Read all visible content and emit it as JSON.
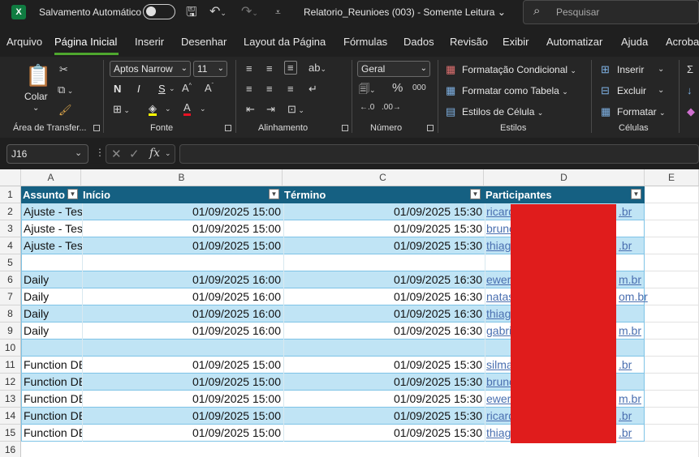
{
  "titlebar": {
    "app_icon": "X",
    "autosave_label": "Salvamento Automático",
    "doc_title": "Relatorio_Reunioes (003)  -  Somente Leitura",
    "search_placeholder": "Pesquisar"
  },
  "tabs": [
    "Arquivo",
    "Página Inicial",
    "Inserir",
    "Desenhar",
    "Layout da Página",
    "Fórmulas",
    "Dados",
    "Revisão",
    "Exibir",
    "Automatizar",
    "Ajuda",
    "Acrobat"
  ],
  "ribbon": {
    "paste_label": "Colar",
    "font_name": "Aptos Narrow",
    "font_size": "11",
    "bold": "N",
    "italic": "I",
    "underline": "S",
    "number_format": "Geral",
    "cond_format": "Formatação Condicional",
    "format_table": "Formatar como Tabela",
    "cell_styles": "Estilos de Célula",
    "insert": "Inserir",
    "delete": "Excluir",
    "format": "Formatar",
    "groups": {
      "clipboard": "Área de Transfer...",
      "font": "Fonte",
      "alignment": "Alinhamento",
      "number": "Número",
      "styles": "Estilos",
      "cells": "Células"
    }
  },
  "formula_bar": {
    "namebox": "J16",
    "fx": "fx",
    "formula": ""
  },
  "grid": {
    "columns": [
      "A",
      "B",
      "C",
      "D",
      "E"
    ],
    "headers": [
      "Assunto",
      "Início",
      "Término",
      "Participantes"
    ],
    "rows": [
      {
        "n": "2",
        "a": "Ajuste - Teste",
        "b": "01/09/2025 15:00",
        "c": "01/09/2025 15:30",
        "d": "ricardo",
        "d2": ".br"
      },
      {
        "n": "3",
        "a": "Ajuste - Teste",
        "b": "01/09/2025 15:00",
        "c": "01/09/2025 15:30",
        "d": "bruno",
        "d2": ""
      },
      {
        "n": "4",
        "a": "Ajuste - Teste",
        "b": "01/09/2025 15:00",
        "c": "01/09/2025 15:30",
        "d": "thiago",
        "d2": ".br"
      },
      {
        "n": "5",
        "a": "",
        "b": "",
        "c": "",
        "d": "",
        "d2": ""
      },
      {
        "n": "6",
        "a": "Daily",
        "b": "01/09/2025 16:00",
        "c": "01/09/2025 16:30",
        "d": "ewert",
        "d2": "m.br"
      },
      {
        "n": "7",
        "a": "Daily",
        "b": "01/09/2025 16:00",
        "c": "01/09/2025 16:30",
        "d": "natas",
        "d2": "om.br"
      },
      {
        "n": "8",
        "a": "Daily",
        "b": "01/09/2025 16:00",
        "c": "01/09/2025 16:30",
        "d": "thiago",
        "d2": ""
      },
      {
        "n": "9",
        "a": "Daily",
        "b": "01/09/2025 16:00",
        "c": "01/09/2025 16:30",
        "d": "gabri",
        "d2": "m.br"
      },
      {
        "n": "10",
        "a": "",
        "b": "",
        "c": "",
        "d": "",
        "d2": ""
      },
      {
        "n": "11",
        "a": "Function DEV",
        "b": "01/09/2025 15:00",
        "c": "01/09/2025 15:30",
        "d": "silma",
        "d2": ".br"
      },
      {
        "n": "12",
        "a": "Function DEV",
        "b": "01/09/2025 15:00",
        "c": "01/09/2025 15:30",
        "d": "bruno",
        "d2": ""
      },
      {
        "n": "13",
        "a": "Function DEV",
        "b": "01/09/2025 15:00",
        "c": "01/09/2025 15:30",
        "d": "ewert",
        "d2": "m.br"
      },
      {
        "n": "14",
        "a": "Function DEV",
        "b": "01/09/2025 15:00",
        "c": "01/09/2025 15:30",
        "d": "ricardo",
        "d2": ".br"
      },
      {
        "n": "15",
        "a": "Function DEV",
        "b": "01/09/2025 15:00",
        "c": "01/09/2025 15:30",
        "d": "thiago",
        "d2": ".br"
      }
    ],
    "last_row": "16"
  },
  "colors": {
    "header_fill": "#156082",
    "band_fill": "#c0e4f5",
    "accent": "#4ea72e",
    "redaction": "#e01c1c"
  }
}
